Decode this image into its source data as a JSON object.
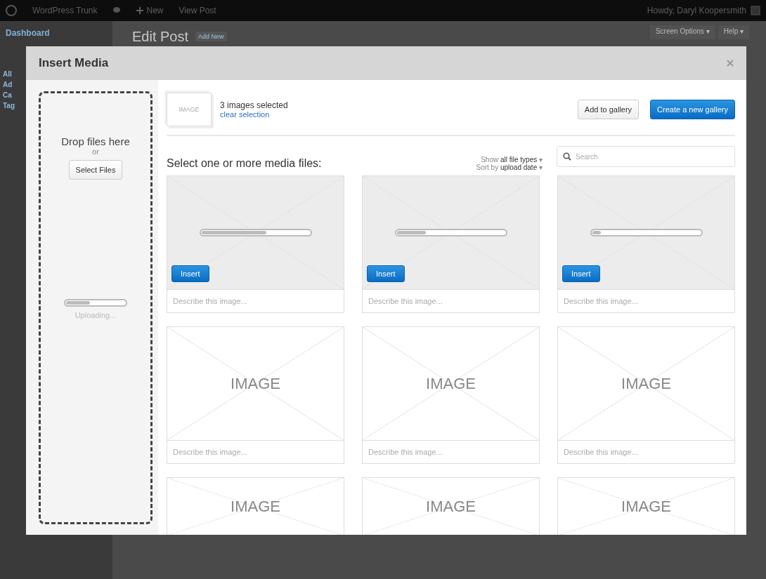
{
  "admin_bar": {
    "site": "WordPress Trunk",
    "new": "New",
    "view": "View Post",
    "greeting": "Howdy, Daryl Koopersmith"
  },
  "sidebar": {
    "items": [
      {
        "label": "Dashboard"
      }
    ],
    "submenu": [
      "All",
      "Ad",
      "Ca",
      "Tag"
    ]
  },
  "page": {
    "title": "Edit Post",
    "add_new": "Add New",
    "screen_options": "Screen Options",
    "help": "Help",
    "caret": "▾"
  },
  "modal": {
    "title": "Insert Media",
    "uploader": {
      "drop_text": "Drop files here",
      "or": "or",
      "select_button": "Select Files",
      "level": 0.4,
      "status": "Uploading..."
    },
    "selection": {
      "thumb_label": "IMAGE",
      "count": "3 images selected",
      "clear": "clear selection"
    },
    "buttons": [
      {
        "label": "Add to gallery",
        "kind": "secondary"
      },
      {
        "label": "Create a new gallery",
        "kind": "primary"
      }
    ],
    "heading": "Select one or more media files:",
    "filters": [
      {
        "prefix": "Show",
        "value": "all file types",
        "caret": "▾"
      },
      {
        "prefix": "Sort by",
        "value": "upload date",
        "caret": "▾"
      }
    ],
    "search": {
      "placeholder": "Search"
    },
    "tiles": [
      {
        "kind": "uploading",
        "level": 0.6,
        "button": "Insert",
        "placeholder": "Describe this image..."
      },
      {
        "kind": "uploading",
        "level": 0.27,
        "button": "Insert",
        "placeholder": "Describe this image..."
      },
      {
        "kind": "uploading",
        "level": 0.08,
        "button": "Insert",
        "placeholder": "Describe this image..."
      },
      {
        "kind": "image",
        "label": "IMAGE",
        "placeholder": "Describe this image..."
      },
      {
        "kind": "image",
        "label": "IMAGE",
        "placeholder": "Describe this image..."
      },
      {
        "kind": "image",
        "label": "IMAGE",
        "placeholder": "Describe this image..."
      },
      {
        "kind": "image",
        "label": "IMAGE"
      },
      {
        "kind": "image",
        "label": "IMAGE"
      },
      {
        "kind": "image",
        "label": "IMAGE"
      }
    ]
  }
}
